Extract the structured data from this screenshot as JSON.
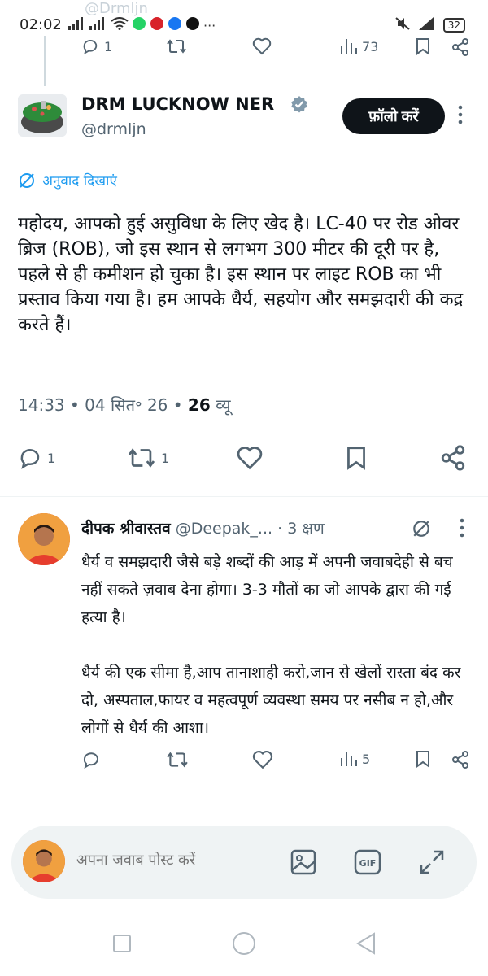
{
  "status_bar": {
    "time": "02:02",
    "battery": "32",
    "ghost_handle": "@Drmljn"
  },
  "top_tweet_actions": {
    "reply_count": "1",
    "views_count": "73"
  },
  "tweet": {
    "author_name": "DRM LUCKNOW NER",
    "author_handle": "@drmljn",
    "follow_label": "फ़ॉलो करें",
    "translate_label": "अनुवाद दिखाएं",
    "text": "महोदय, आपको हुई असुविधा के लिए खेद है। LC-40 पर रोड ओवर ब्रिज (ROB), जो इस स्थान से लगभग 300 मीटर की दूरी पर है, पहले से ही कमीशन हो चुका है। इस स्थान पर लाइट ROB का भी प्रस्ताव किया गया है। हम आपके धैर्य, सहयोग और समझदारी की कद्र करते हैं।",
    "time": "14:33",
    "date": "04 सित॰ 26",
    "views": "26",
    "views_label": "व्यू",
    "reply_count": "1",
    "retweet_count": "1"
  },
  "reply": {
    "author_name": "दीपक श्रीवास्तव",
    "author_handle": "@Deepak_...",
    "time_ago": "3 क्षण",
    "paragraph1": "धैर्य व समझदारी जैसे बड़े शब्दों की आड़ में अपनी जवाबदेही से बच नहीं सकते ज़वाब देना होगा। 3-3 मौतों का जो आपके द्वारा की गई हत्या है।",
    "paragraph2": "धैर्य की एक सीमा है,आप तानाशाही करो,जान से खेलों रास्ता बंद कर दो, अस्पताल,फायर व महत्वपूर्ण व्यवस्था समय पर नसीब न हो,और लोगों से धैर्य की आशा।",
    "views_count": "5"
  },
  "composer": {
    "placeholder": "अपना जवाब पोस्ट करें",
    "gif_label": "GIF"
  },
  "colors": {
    "accent": "#1d9bf0",
    "muted": "#536471",
    "text": "#0f1419"
  }
}
